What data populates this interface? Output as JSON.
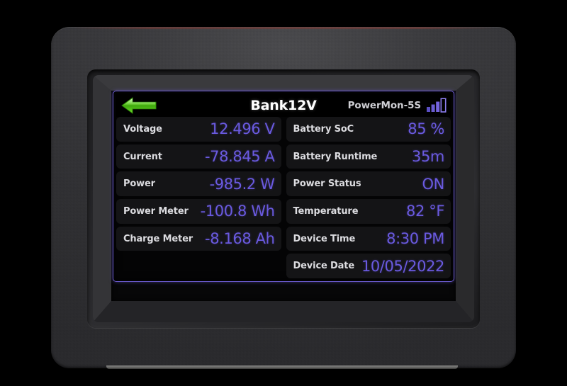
{
  "screen": {
    "titlebar": {
      "back_icon": "back-arrow-icon",
      "title": "Bank12V",
      "device_name": "PowerMon-5S",
      "signal_icon": "signal-bars-icon",
      "signal_bars_filled": 3,
      "signal_bars_total": 4
    },
    "left_column": [
      {
        "label": "Voltage",
        "value": "12.496 V"
      },
      {
        "label": "Current",
        "value": "-78.845 A"
      },
      {
        "label": "Power",
        "value": "-985.2 W"
      },
      {
        "label": "Power Meter",
        "value": "-100.8 Wh"
      },
      {
        "label": "Charge Meter",
        "value": "-8.168 Ah"
      },
      {
        "label": "",
        "value": ""
      }
    ],
    "right_column": [
      {
        "label": "Battery SoC",
        "value": "85 %"
      },
      {
        "label": "Battery Runtime",
        "value": "35m"
      },
      {
        "label": "Power Status",
        "value": "ON"
      },
      {
        "label": "Temperature",
        "value": "82 °F"
      },
      {
        "label": "Device Time",
        "value": "8:30 PM"
      },
      {
        "label": "Device Date",
        "value": "10/05/2022"
      }
    ]
  },
  "colors": {
    "accent_value": "#6a5ae0",
    "screen_border": "#6a5acd",
    "label_text": "#dcdce0",
    "title_text": "#ffffff",
    "device_name_text": "#cfcfd4",
    "row_background": "#141416",
    "screen_background": "#040405",
    "back_arrow_green": "#52c41a",
    "bezel": "#303033",
    "page_background": "#000000"
  }
}
